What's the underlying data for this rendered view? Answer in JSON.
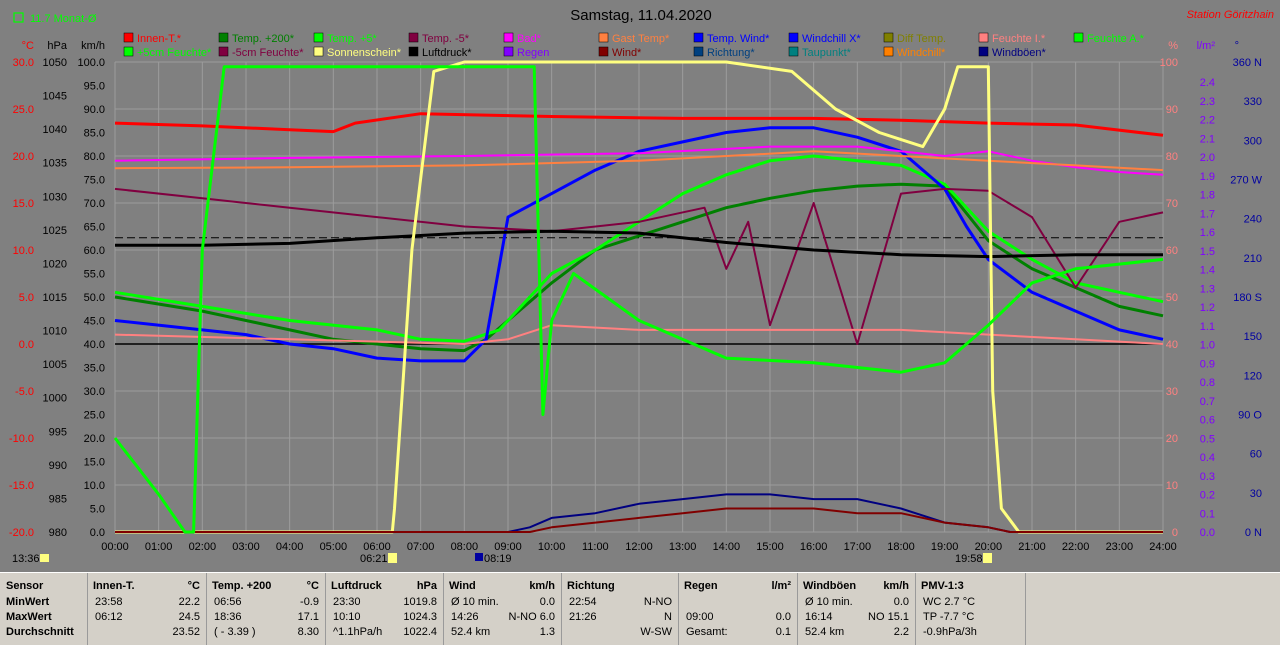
{
  "chart_data": {
    "type": "line",
    "title": "Samstag, 11.04.2020",
    "station": "Station Göritzhain",
    "month_avg": "11.7 Monat-Ø",
    "axes_left": [
      {
        "unit": "°C",
        "color": "#ff0000",
        "ticks": [
          "30.0",
          "25.0",
          "20.0",
          "15.0",
          "10.0",
          "5.0",
          "0.0",
          "-5.0",
          "-10.0",
          "-15.0",
          "-20.0"
        ]
      },
      {
        "unit": "hPa",
        "color": "#000000",
        "ticks": [
          "1050",
          "1045",
          "1040",
          "1035",
          "1030",
          "1025",
          "1020",
          "1015",
          "1010",
          "1005",
          "1000",
          "995",
          "990",
          "985",
          "980"
        ]
      },
      {
        "unit": "km/h",
        "color": "#000000",
        "ticks": [
          "100.0",
          "95.0",
          "90.0",
          "85.0",
          "80.0",
          "75.0",
          "70.0",
          "65.0",
          "60.0",
          "55.0",
          "50.0",
          "45.0",
          "40.0",
          "35.0",
          "30.0",
          "25.0",
          "20.0",
          "15.0",
          "10.0",
          "5.0",
          "0.0"
        ]
      }
    ],
    "axes_right": [
      {
        "unit": "%",
        "color": "#ff8080",
        "ticks": [
          "100",
          "90",
          "80",
          "70",
          "60",
          "50",
          "40",
          "30",
          "20",
          "10",
          "0"
        ]
      },
      {
        "unit": "l/m²",
        "color": "#8000ff",
        "ticks": [
          "2.4",
          "2.3",
          "2.2",
          "2.1",
          "2.0",
          "1.9",
          "1.8",
          "1.7",
          "1.6",
          "1.5",
          "1.4",
          "1.3",
          "1.2",
          "1.1",
          "1.0",
          "0.9",
          "0.8",
          "0.7",
          "0.6",
          "0.5",
          "0.4",
          "0.3",
          "0.2",
          "0.1",
          "0.0"
        ]
      },
      {
        "unit": "°",
        "color": "#0000a0",
        "ticks": [
          "360 N",
          "330",
          "300",
          "270 W",
          "240",
          "210",
          "180 S",
          "150",
          "120",
          "90 O",
          "60",
          "30",
          "0 N"
        ]
      }
    ],
    "x_ticks": [
      "00:00",
      "01:00",
      "02:00",
      "03:00",
      "04:00",
      "05:00",
      "06:00",
      "07:00",
      "08:00",
      "09:00",
      "10:00",
      "11:00",
      "12:00",
      "13:00",
      "14:00",
      "15:00",
      "16:00",
      "17:00",
      "18:00",
      "19:00",
      "20:00",
      "21:00",
      "22:00",
      "23:00",
      "24:00"
    ],
    "markers": {
      "clock": "13:36",
      "sunrise": "06:21",
      "sunset": "19:58",
      "other": "08:19"
    },
    "legend": [
      {
        "label": "Innen-T.*",
        "color": "#ff0000"
      },
      {
        "label": "Temp. +200*",
        "color": "#008000"
      },
      {
        "label": "Temp. +5*",
        "color": "#00ff00"
      },
      {
        "label": "Temp. -5*",
        "color": "#800040"
      },
      {
        "label": "Bad*",
        "color": "#ff00ff"
      },
      {
        "label": "Gast Temp*",
        "color": "#ff8040"
      },
      {
        "label": "Temp. Wind*",
        "color": "#0000ff"
      },
      {
        "label": "Windchill X*",
        "color": "#0000ff"
      },
      {
        "label": "Diff Temp.",
        "color": "#808000"
      },
      {
        "label": "Feuchte I.*",
        "color": "#ff8080"
      },
      {
        "label": "Feuchte A.*",
        "color": "#00ff00"
      },
      {
        "label": "+5cm Feuchte*",
        "color": "#00ff00"
      },
      {
        "label": "-5cm Feuchte*",
        "color": "#800040"
      },
      {
        "label": "Sonnenschein*",
        "color": "#ffff80"
      },
      {
        "label": "Luftdruck*",
        "color": "#000000"
      },
      {
        "label": "Regen",
        "color": "#8000ff"
      },
      {
        "label": "Wind*",
        "color": "#800000"
      },
      {
        "label": "Richtung*",
        "color": "#004080"
      },
      {
        "label": "Taupunkt*",
        "color": "#008080"
      },
      {
        "label": "Windchill*",
        "color": "#ff8000"
      },
      {
        "label": "Windböen*",
        "color": "#000080"
      }
    ],
    "series": [
      {
        "name": "Innen-T.*",
        "axis": "temp",
        "color": "#ff0000",
        "width": 3,
        "x": [
          0,
          2,
          4,
          5,
          5.5,
          7,
          10,
          13,
          16,
          18,
          20,
          22,
          24
        ],
        "y": [
          23.5,
          23.2,
          22.8,
          22.6,
          23.5,
          24.5,
          24.2,
          24.0,
          24.0,
          23.8,
          23.5,
          23.3,
          22.2
        ]
      },
      {
        "name": "Temp. +200*",
        "axis": "temp",
        "color": "#008000",
        "width": 3,
        "x": [
          0,
          2,
          4,
          5,
          6,
          7,
          8,
          8.5,
          9,
          10,
          11,
          12,
          13,
          14,
          15,
          16,
          17,
          18,
          19,
          20,
          21,
          22,
          23,
          24
        ],
        "y": [
          5.0,
          3.5,
          1.5,
          0.5,
          0,
          -0.5,
          -0.7,
          0.5,
          2.5,
          6.5,
          10.0,
          11.5,
          13.0,
          14.5,
          15.5,
          16.3,
          16.8,
          17.0,
          16.8,
          11.0,
          8.0,
          6.0,
          4.0,
          3.0
        ]
      },
      {
        "name": "Temp. +5*",
        "axis": "temp",
        "color": "#00ff00",
        "width": 3,
        "x": [
          0,
          2,
          4,
          6,
          7,
          8,
          8.8,
          9.5,
          10,
          11,
          12,
          13,
          14,
          15,
          16,
          17,
          18,
          19,
          20,
          21,
          22,
          23,
          24
        ],
        "y": [
          5.5,
          4.0,
          2.5,
          1.5,
          0.5,
          0.3,
          1.5,
          5.0,
          7.5,
          10.0,
          13.0,
          16.0,
          18.0,
          19.5,
          20.0,
          19.5,
          19.0,
          17.0,
          12.0,
          9.0,
          6.5,
          5.5,
          4.5
        ]
      },
      {
        "name": "Windchill X*",
        "axis": "temp",
        "color": "#0000ff",
        "width": 3,
        "x": [
          0,
          2,
          3,
          4,
          5,
          6,
          7,
          8,
          8.5,
          9,
          10,
          11,
          12,
          13,
          14,
          15,
          16,
          17,
          18,
          19,
          19.5,
          20,
          21,
          22,
          23,
          24
        ],
        "y": [
          2.5,
          1.5,
          1.0,
          0,
          -0.5,
          -1.5,
          -1.8,
          -1.8,
          0.5,
          13.5,
          16.0,
          18.5,
          20.5,
          21.5,
          22.5,
          23.0,
          23.0,
          22.0,
          20.5,
          16.5,
          12.5,
          9.0,
          5.5,
          3.5,
          1.5,
          0.5
        ]
      },
      {
        "name": "Temp. -5*",
        "axis": "temp",
        "color": "#800040",
        "width": 2,
        "x": [
          0,
          2,
          4,
          6,
          8,
          10,
          12,
          13.5,
          14,
          14.5,
          15,
          16,
          17,
          18,
          19,
          20,
          21,
          22,
          23,
          24
        ],
        "y": [
          16.5,
          15.5,
          14.5,
          13.5,
          12.5,
          12.0,
          13.0,
          14.5,
          8.0,
          13.0,
          2.0,
          15.0,
          0.0,
          16.0,
          16.5,
          16.3,
          13.5,
          6.0,
          13.0,
          14.0
        ]
      },
      {
        "name": "Bad*",
        "axis": "temp",
        "color": "#ff00ff",
        "width": 2,
        "x": [
          0,
          4,
          8,
          12,
          15,
          17,
          19,
          20,
          21,
          22,
          23,
          24
        ],
        "y": [
          19.5,
          19.8,
          20.0,
          20.3,
          21.0,
          21.0,
          20.0,
          20.5,
          19.5,
          18.8,
          18.3,
          18.0
        ]
      },
      {
        "name": "Gast Temp*",
        "axis": "temp",
        "color": "#ff8040",
        "width": 2,
        "x": [
          0,
          4,
          8,
          12,
          16,
          18,
          20,
          22,
          24
        ],
        "y": [
          18.7,
          18.8,
          19.0,
          19.5,
          20.5,
          20.0,
          19.5,
          19.0,
          18.5
        ]
      },
      {
        "name": "Luftdruck*",
        "axis": "temp",
        "color": "#000000",
        "width": 3,
        "x": [
          0,
          2,
          4,
          6,
          8,
          10,
          12,
          14,
          16,
          18,
          20,
          22,
          24
        ],
        "y": [
          10.5,
          10.5,
          10.7,
          11.3,
          11.8,
          12.0,
          11.8,
          10.8,
          10.0,
          9.5,
          9.3,
          9.5,
          9.5
        ]
      },
      {
        "name": "Feuchte I.*",
        "axis": "pct",
        "color": "#ff8080",
        "width": 2,
        "x": [
          0,
          4,
          8,
          9,
          10,
          12,
          14,
          18,
          20,
          22,
          24
        ],
        "y": [
          42,
          41,
          40,
          41,
          44,
          43,
          43,
          43,
          42,
          41,
          40
        ]
      },
      {
        "name": "Sonnenschein*",
        "axis": "pct",
        "color": "#ffff80",
        "width": 3,
        "x": [
          0,
          6.35,
          6.4,
          6.8,
          7.3,
          8,
          10,
          14,
          15.5,
          16.5,
          17.5,
          18.5,
          19,
          19.3,
          20,
          20.1,
          20.3,
          20.7,
          24
        ],
        "y": [
          0,
          0,
          5,
          60,
          98,
          100,
          100,
          100,
          98,
          90,
          85,
          82,
          90,
          99,
          99,
          30,
          5,
          0,
          0
        ]
      },
      {
        "name": "Windböen*",
        "axis": "kmh",
        "color": "#000080",
        "width": 2,
        "x": [
          0,
          9,
          9.5,
          10,
          11,
          12,
          13,
          14,
          15,
          16,
          17,
          18,
          19,
          20,
          20.5,
          24
        ],
        "y": [
          0,
          0,
          1,
          3,
          4,
          6,
          7,
          8,
          8,
          7,
          7,
          5,
          2,
          1,
          0,
          0
        ]
      },
      {
        "name": "Wind*",
        "axis": "kmh",
        "color": "#800000",
        "width": 2,
        "x": [
          0,
          9.5,
          10,
          11,
          12,
          13,
          14,
          15,
          16,
          17,
          18,
          19,
          20,
          20.5,
          24
        ],
        "y": [
          0,
          0,
          1,
          2,
          3,
          4,
          5,
          5,
          5,
          4,
          4,
          2,
          1,
          0,
          0
        ]
      },
      {
        "name": "+5cm Feuchte*",
        "axis": "pct",
        "color": "#00ff00",
        "width": 3,
        "x": [
          0,
          1,
          1.6,
          1.8,
          2,
          2.5,
          3,
          8,
          9,
          9.6,
          9.8,
          10,
          10.5,
          12,
          14,
          16,
          18,
          19,
          20,
          21,
          22,
          23,
          24
        ],
        "y": [
          20,
          8,
          0,
          0,
          60,
          99,
          99,
          99,
          99,
          99,
          25,
          45,
          55,
          45,
          37,
          36,
          34,
          36,
          44,
          53,
          56,
          57,
          58
        ]
      }
    ],
    "ranges": {
      "temp": [
        -20,
        30
      ],
      "pct": [
        0,
        100
      ],
      "kmh": [
        0,
        100
      ],
      "hours": [
        0,
        24
      ]
    }
  },
  "stats": {
    "columns": [
      {
        "header": "Sensor",
        "rows": [
          "MinWert",
          "MaxWert",
          "Durchschnitt"
        ]
      },
      {
        "header": "Innen-T.",
        "unit": "°C",
        "rows": [
          [
            "23:58",
            "22.2"
          ],
          [
            "06:12",
            "24.5"
          ],
          [
            "",
            "23.52"
          ]
        ]
      },
      {
        "header": "Temp. +200",
        "unit": "°C",
        "rows": [
          [
            "06:56",
            "-0.9"
          ],
          [
            "18:36",
            "17.1"
          ],
          [
            "( - 3.39 )",
            "8.30"
          ]
        ]
      },
      {
        "header": "Luftdruck",
        "unit": "hPa",
        "rows": [
          [
            "23:30",
            "1019.8"
          ],
          [
            "10:10",
            "1024.3"
          ],
          [
            "^1.1hPa/h",
            "1022.4"
          ]
        ]
      },
      {
        "header": "Wind",
        "unit": "km/h",
        "rows": [
          [
            "Ø 10 min.",
            "0.0"
          ],
          [
            "14:26",
            "N-NO 6.0"
          ],
          [
            "52.4 km",
            "1.3"
          ]
        ]
      },
      {
        "header": "Richtung",
        "unit": "",
        "rows": [
          [
            "22:54",
            "N-NO"
          ],
          [
            "21:26",
            "N"
          ],
          [
            "",
            "W-SW"
          ]
        ]
      },
      {
        "header": "Regen",
        "unit": "l/m²",
        "rows": [
          [
            "",
            ""
          ],
          [
            "09:00",
            "0.0"
          ],
          [
            "Gesamt:",
            "0.1"
          ]
        ]
      },
      {
        "header": "Windböen",
        "unit": "km/h",
        "rows": [
          [
            "Ø 10 min.",
            "0.0"
          ],
          [
            "16:14",
            "NO 15.1"
          ],
          [
            "52.4 km",
            "2.2"
          ]
        ]
      },
      {
        "header": "PMV-1:3",
        "unit": "",
        "rows": [
          [
            "WC 2.7 °C",
            ""
          ],
          [
            "TP -7.7 °C",
            ""
          ],
          [
            "-0.9hPa/3h",
            ""
          ]
        ]
      }
    ]
  }
}
